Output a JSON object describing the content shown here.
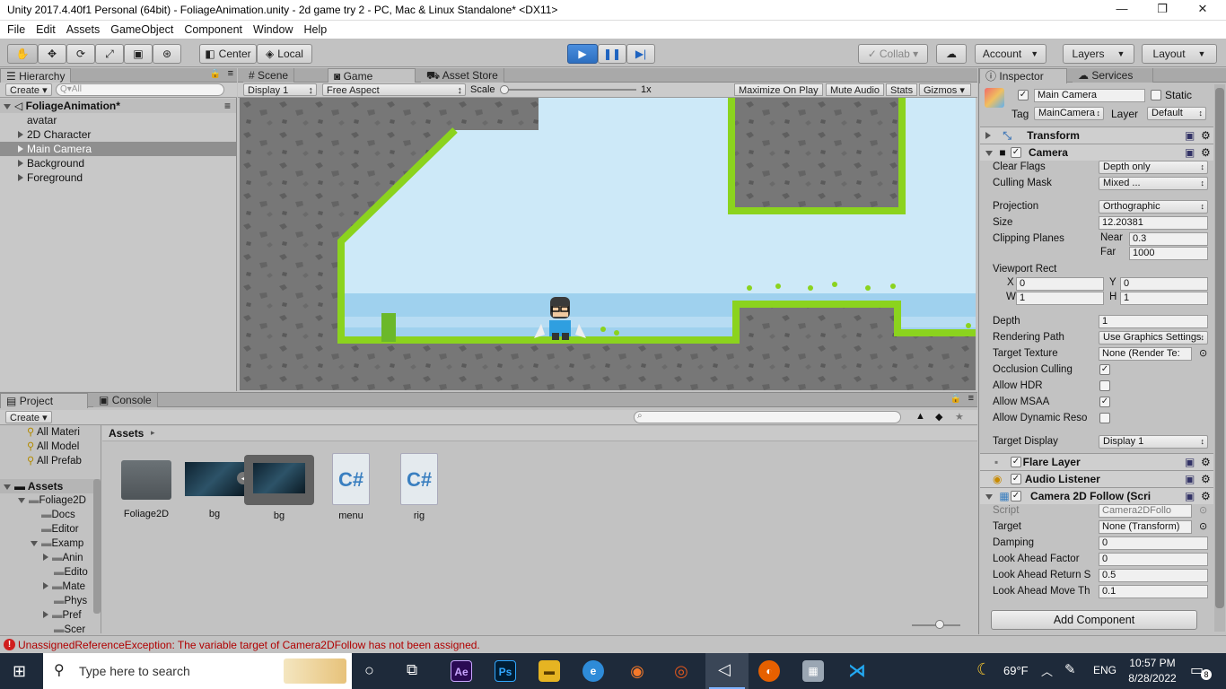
{
  "window": {
    "title": "Unity 2017.4.40f1 Personal (64bit) - FoliageAnimation.unity - 2d game try 2 - PC, Mac & Linux Standalone* <DX11>",
    "minimize": "—",
    "restore": "❐",
    "close": "✕"
  },
  "menu": [
    "File",
    "Edit",
    "Assets",
    "GameObject",
    "Component",
    "Window",
    "Help"
  ],
  "toolbar": {
    "pivot": "Center",
    "space": "Local",
    "collab": "Collab ▾",
    "account": "Account",
    "layers": "Layers",
    "layout": "Layout"
  },
  "hierarchy": {
    "tab": "Hierarchy",
    "create": "Create",
    "search_placeholder": "Q▾All",
    "scene": "FoliageAnimation*",
    "items": [
      "avatar",
      "2D Character",
      "Main Camera",
      "Background",
      "Foreground"
    ]
  },
  "game_view": {
    "tabs": [
      "Scene",
      "Game",
      "Asset Store"
    ],
    "display": "Display 1",
    "aspect": "Free Aspect",
    "scale_label": "Scale",
    "scale_value": "1x",
    "toggles": [
      "Maximize On Play",
      "Mute Audio",
      "Stats",
      "Gizmos"
    ]
  },
  "project": {
    "tabs": [
      "Project",
      "Console"
    ],
    "create": "Create",
    "favorites": [
      "All Materi",
      "All Model",
      "All Prefab"
    ],
    "tree_root": "Assets",
    "tree": [
      "Foliage2D",
      "Docs",
      "Editor",
      "Examp",
      "Anin",
      "Edito",
      "Mate",
      "Phys",
      "Pref",
      "Scer"
    ],
    "breadcrumb": "Assets",
    "assets": [
      "Foliage2D",
      "bg",
      "bg",
      "menu",
      "rig"
    ]
  },
  "inspector": {
    "tabs": [
      "Inspector",
      "Services"
    ],
    "name": "Main Camera",
    "static_label": "Static",
    "tag_label": "Tag",
    "tag_value": "MainCamera",
    "layer_label": "Layer",
    "layer_value": "Default",
    "transform_title": "Transform",
    "camera_title": "Camera",
    "camera_rows": [
      {
        "label": "Clear Flags",
        "value": "Depth only"
      },
      {
        "label": "Culling Mask",
        "value": "Mixed ..."
      },
      {
        "label": "Projection",
        "value": "Orthographic"
      },
      {
        "label": "Size",
        "value": "12.20381"
      },
      {
        "label": "Clipping Planes",
        "value": ""
      },
      {
        "label": "Viewport Rect",
        "value": ""
      },
      {
        "label": "Depth",
        "value": "1"
      },
      {
        "label": "Rendering Path",
        "value": "Use Graphics Settings"
      },
      {
        "label": "Target Texture",
        "value": "None (Render Te:"
      },
      {
        "label": "Occlusion Culling",
        "value": ""
      },
      {
        "label": "Allow HDR",
        "value": ""
      },
      {
        "label": "Allow MSAA",
        "value": ""
      },
      {
        "label": "Allow Dynamic Reso",
        "value": ""
      },
      {
        "label": "Target Display",
        "value": "Display 1"
      }
    ],
    "near_label": "Near",
    "near": "0.3",
    "far_label": "Far",
    "far": "1000",
    "vp": {
      "x_label": "X",
      "x": "0",
      "y_label": "Y",
      "y": "0",
      "w_label": "W",
      "w": "1",
      "h_label": "H",
      "h": "1"
    },
    "flare_title": "Flare Layer",
    "audio_title": "Audio Listener",
    "follow_title": "Camera 2D Follow (Scri",
    "follow_rows": [
      {
        "label": "Script",
        "value": "Camera2DFollo"
      },
      {
        "label": "Target",
        "value": "None (Transform)"
      },
      {
        "label": "Damping",
        "value": "0"
      },
      {
        "label": "Look Ahead Factor",
        "value": "0"
      },
      {
        "label": "Look Ahead Return S",
        "value": "0.5"
      },
      {
        "label": "Look Ahead Move Th",
        "value": "0.1"
      }
    ],
    "add_component": "Add Component"
  },
  "status": {
    "error": "UnassignedReferenceException: The variable target of Camera2DFollow has not been assigned."
  },
  "taskbar": {
    "search": "Type here to search",
    "weather": "69°F",
    "lang": "ENG",
    "time": "10:57 PM",
    "date": "8/28/2022",
    "notifications": "8"
  }
}
